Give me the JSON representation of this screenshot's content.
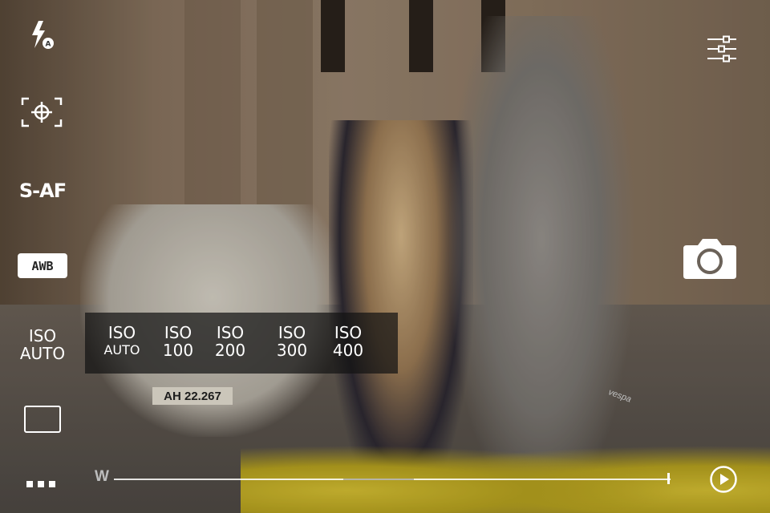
{
  "camera": {
    "left_controls": {
      "focus_mode": "S-AF",
      "white_balance": "AWB",
      "iso_current": {
        "line1": "ISO",
        "line2": "AUTO"
      }
    },
    "iso_menu": {
      "options": [
        {
          "line1": "ISO",
          "line2": "AUTO"
        },
        {
          "line1": "ISO",
          "line2": "100"
        },
        {
          "line1": "ISO",
          "line2": "200"
        },
        {
          "line1": "ISO",
          "line2": "300"
        },
        {
          "line1": "ISO",
          "line2": "400"
        }
      ]
    },
    "zoom": {
      "label": "W",
      "level": 1.0
    },
    "icons": {
      "flash": "flash-auto-icon",
      "focus_point": "focus-point-icon",
      "aspect": "aspect-ratio-icon",
      "more": "more-icon",
      "settings": "sliders-icon",
      "shutter": "camera-icon",
      "playback": "play-icon"
    },
    "scene": {
      "license_plate": "AH 22.267",
      "scooter_badge": "vespa"
    }
  }
}
